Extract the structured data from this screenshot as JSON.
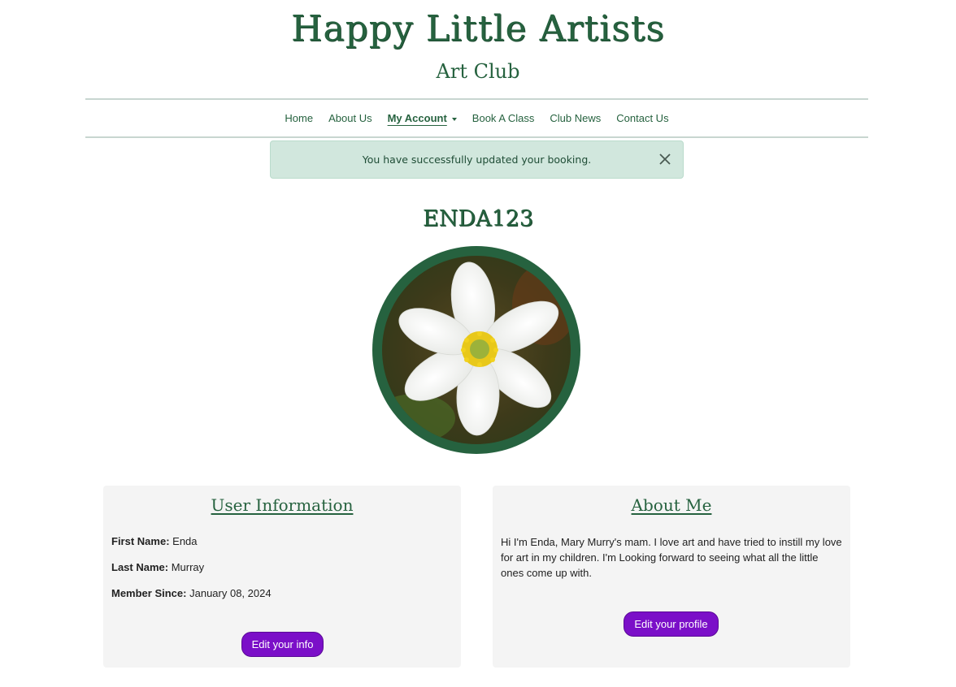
{
  "header": {
    "title": "Happy Little Artists",
    "subtitle": "Art Club"
  },
  "nav": {
    "items": [
      {
        "label": "Home"
      },
      {
        "label": "About Us"
      },
      {
        "label": "My Account"
      },
      {
        "label": "Book A Class"
      },
      {
        "label": "Club News"
      },
      {
        "label": "Contact Us"
      }
    ],
    "active": "My Account"
  },
  "alert": {
    "message": "You have successfully updated your booking.",
    "close_icon": "close-icon"
  },
  "profile": {
    "username": "ENDA123",
    "avatar_icon": "white-flower-avatar"
  },
  "user_info": {
    "title": "User Information",
    "first_name_label": "First Name:",
    "first_name": "Enda",
    "last_name_label": "Last Name:",
    "last_name": "Murray",
    "member_since_label": "Member Since:",
    "member_since": "January 08, 2024",
    "edit_button": "Edit your info"
  },
  "about_me": {
    "title": "About Me",
    "text": "Hi I'm Enda, Mary Murry's mam. I love art and have tried to instill my love for art in my children. I'm Looking forward to seeing what all the little ones come up with.",
    "edit_button": "Edit your profile"
  },
  "colors": {
    "brand_green": "#26623f",
    "button_purple": "#7b0fc8",
    "alert_bg": "#d1e7dd",
    "card_bg": "#f4f4f4"
  }
}
